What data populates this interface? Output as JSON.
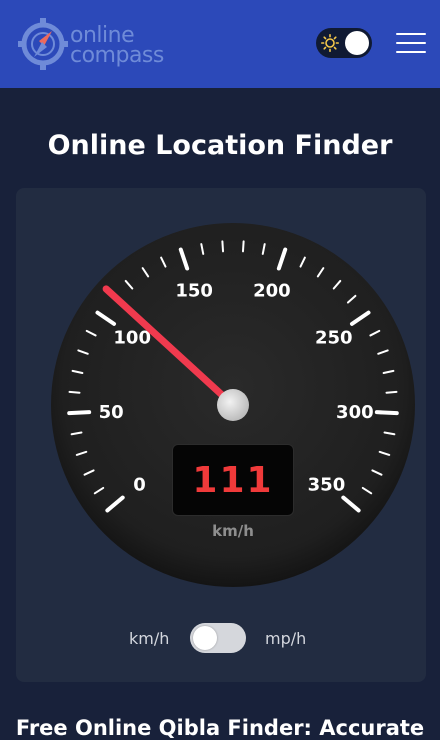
{
  "header": {
    "logo": {
      "line1": "online",
      "line2": "compass"
    },
    "theme_toggle": {
      "state": "light"
    },
    "menu_icon": "hamburger-menu-icon"
  },
  "page_title": "Online Location Finder",
  "speedometer": {
    "labels": [
      "0",
      "50",
      "100",
      "150",
      "200",
      "250",
      "300",
      "350"
    ],
    "speed": "111",
    "unit": "km/h",
    "needle_value": 111,
    "max_value": 350
  },
  "unit_switch": {
    "left_label": "km/h",
    "right_label": "mp/h",
    "selected": "km/h"
  },
  "bottom_heading": "Free Online Qibla Finder: Accurate",
  "colors": {
    "header_bg": "#2c49b9",
    "page_bg": "#18213a",
    "card_bg": "#222c41",
    "needle": "#f03a4e",
    "digital_text": "#f03a3a"
  }
}
